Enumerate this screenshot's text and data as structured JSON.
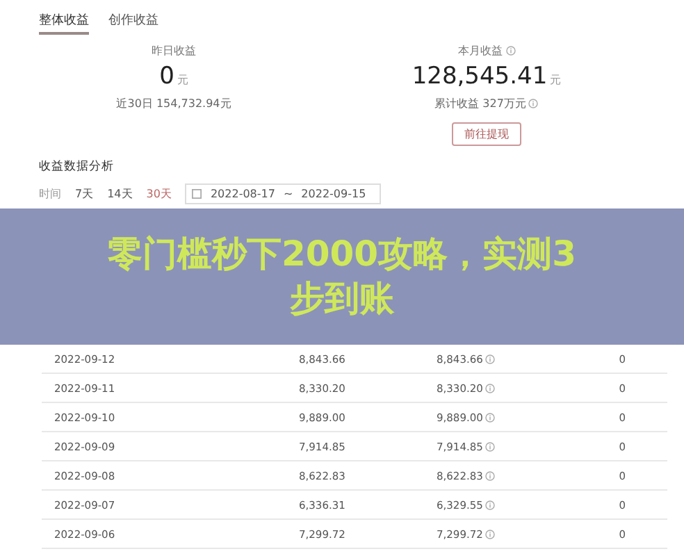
{
  "tabs": [
    {
      "label": "整体收益",
      "selected": true
    },
    {
      "label": "创作收益",
      "selected": false
    }
  ],
  "stats": [
    {
      "label": "昨日收益",
      "label_info": false,
      "value": "0",
      "unit": "元",
      "note": "近30日 154,732.94元",
      "note_info": false
    },
    {
      "label": "本月收益",
      "label_info": true,
      "value": "128,545.41",
      "unit": "元",
      "note": "累计收益 327万元",
      "note_info": true,
      "button": "前往提现"
    }
  ],
  "section_title": "收益数据分析",
  "filter": {
    "label": "时间",
    "ranges": [
      {
        "label": "7天",
        "selected": false
      },
      {
        "label": "14天",
        "selected": false
      },
      {
        "label": "30天",
        "selected": true
      }
    ],
    "start": "2022-08-17",
    "separator": "~",
    "end": "2022-09-15"
  },
  "banner": "零门槛秒下2000攻略，实测3步到账",
  "rows": [
    {
      "date": "2022-09-12",
      "total": "8,843.66",
      "creation": "8,843.66",
      "column_4": "0"
    },
    {
      "date": "2022-09-11",
      "total": "8,330.20",
      "creation": "8,330.20",
      "column_4": "0"
    },
    {
      "date": "2022-09-10",
      "total": "9,889.00",
      "creation": "9,889.00",
      "column_4": "0"
    },
    {
      "date": "2022-09-09",
      "total": "7,914.85",
      "creation": "7,914.85",
      "column_4": "0"
    },
    {
      "date": "2022-09-08",
      "total": "8,622.83",
      "creation": "8,622.83",
      "column_4": "0"
    },
    {
      "date": "2022-09-07",
      "total": "6,336.31",
      "creation": "6,329.55",
      "column_4": "0"
    },
    {
      "date": "2022-09-06",
      "total": "7,299.72",
      "creation": "7,299.72",
      "column_4": "0"
    }
  ]
}
